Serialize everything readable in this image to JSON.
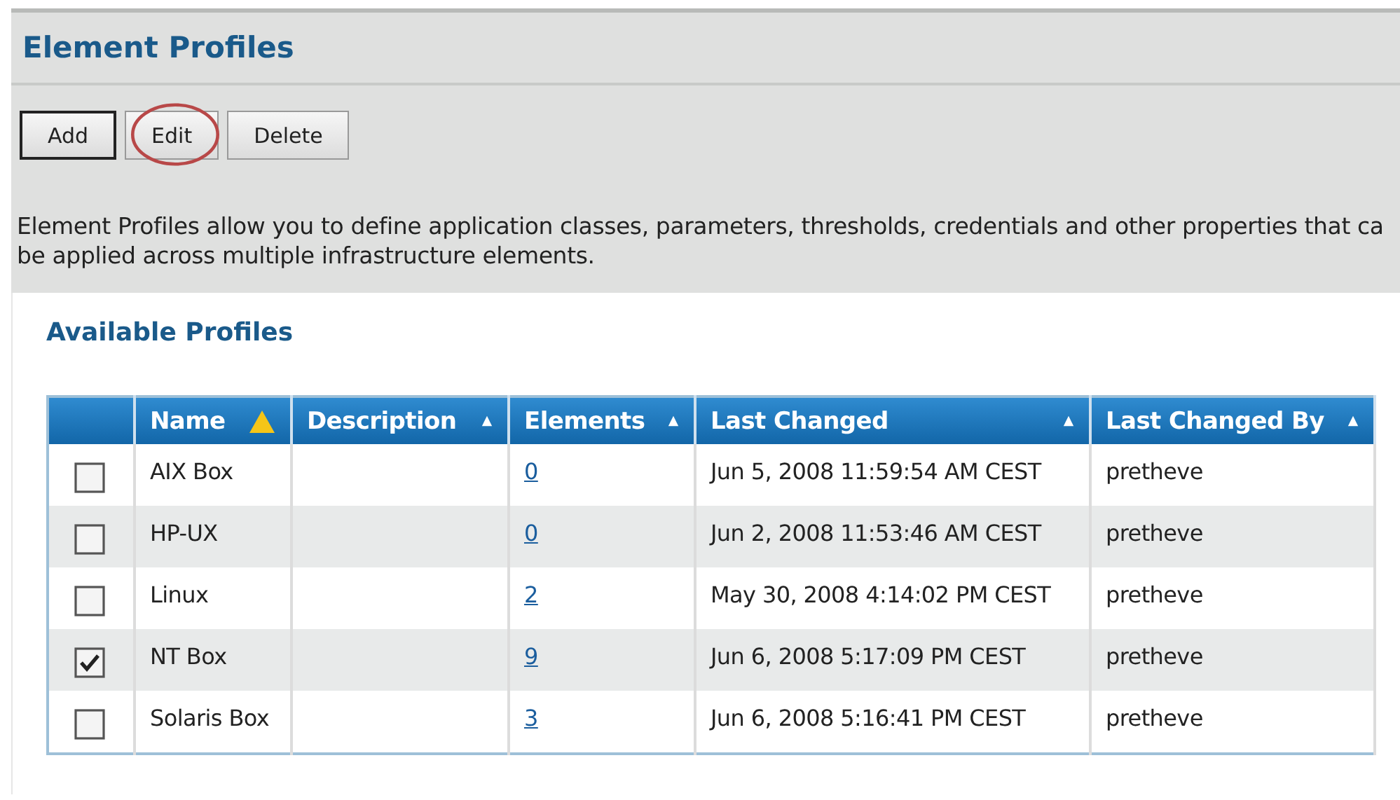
{
  "page": {
    "title": "Element Profiles"
  },
  "buttons": [
    {
      "label": "Add",
      "focused": true,
      "circled": false
    },
    {
      "label": "Edit",
      "focused": false,
      "circled": true
    },
    {
      "label": "Delete",
      "focused": false,
      "circled": false
    }
  ],
  "description_lines": [
    "Element Profiles allow you to define application classes, parameters, thresholds, credentials and other properties that ca",
    "be applied across multiple infrastructure elements."
  ],
  "section": {
    "title": "Available Profiles"
  },
  "table": {
    "columns": [
      {},
      {
        "label": "Name",
        "sortable": true,
        "sorted": true
      },
      {
        "label": "Description",
        "sortable": true,
        "sorted": false
      },
      {
        "label": "Elements",
        "sortable": true,
        "sorted": false
      },
      {
        "label": "Last Changed",
        "sortable": true,
        "sorted": false
      },
      {
        "label": "Last Changed By",
        "sortable": true,
        "sorted": false
      }
    ],
    "rows": [
      {
        "checked": false,
        "name": "AIX Box",
        "elements": "0",
        "last_changed": "Jun 5, 2008 11:59:54 AM CEST",
        "last_changed_by": "pretheve"
      },
      {
        "checked": false,
        "name": "HP-UX",
        "elements": "0",
        "last_changed": "Jun 2, 2008 11:53:46 AM CEST",
        "last_changed_by": "pretheve"
      },
      {
        "checked": false,
        "name": "Linux",
        "elements": "2",
        "last_changed": "May 30, 2008 4:14:02 PM CEST",
        "last_changed_by": "pretheve"
      },
      {
        "checked": true,
        "name": "NT Box",
        "elements": "9",
        "last_changed": "Jun 6, 2008 5:17:09 PM CEST",
        "last_changed_by": "pretheve"
      },
      {
        "checked": false,
        "name": "Solaris Box",
        "elements": "3",
        "last_changed": "Jun 6, 2008 5:16:41 PM CEST",
        "last_changed_by": "pretheve"
      }
    ]
  }
}
